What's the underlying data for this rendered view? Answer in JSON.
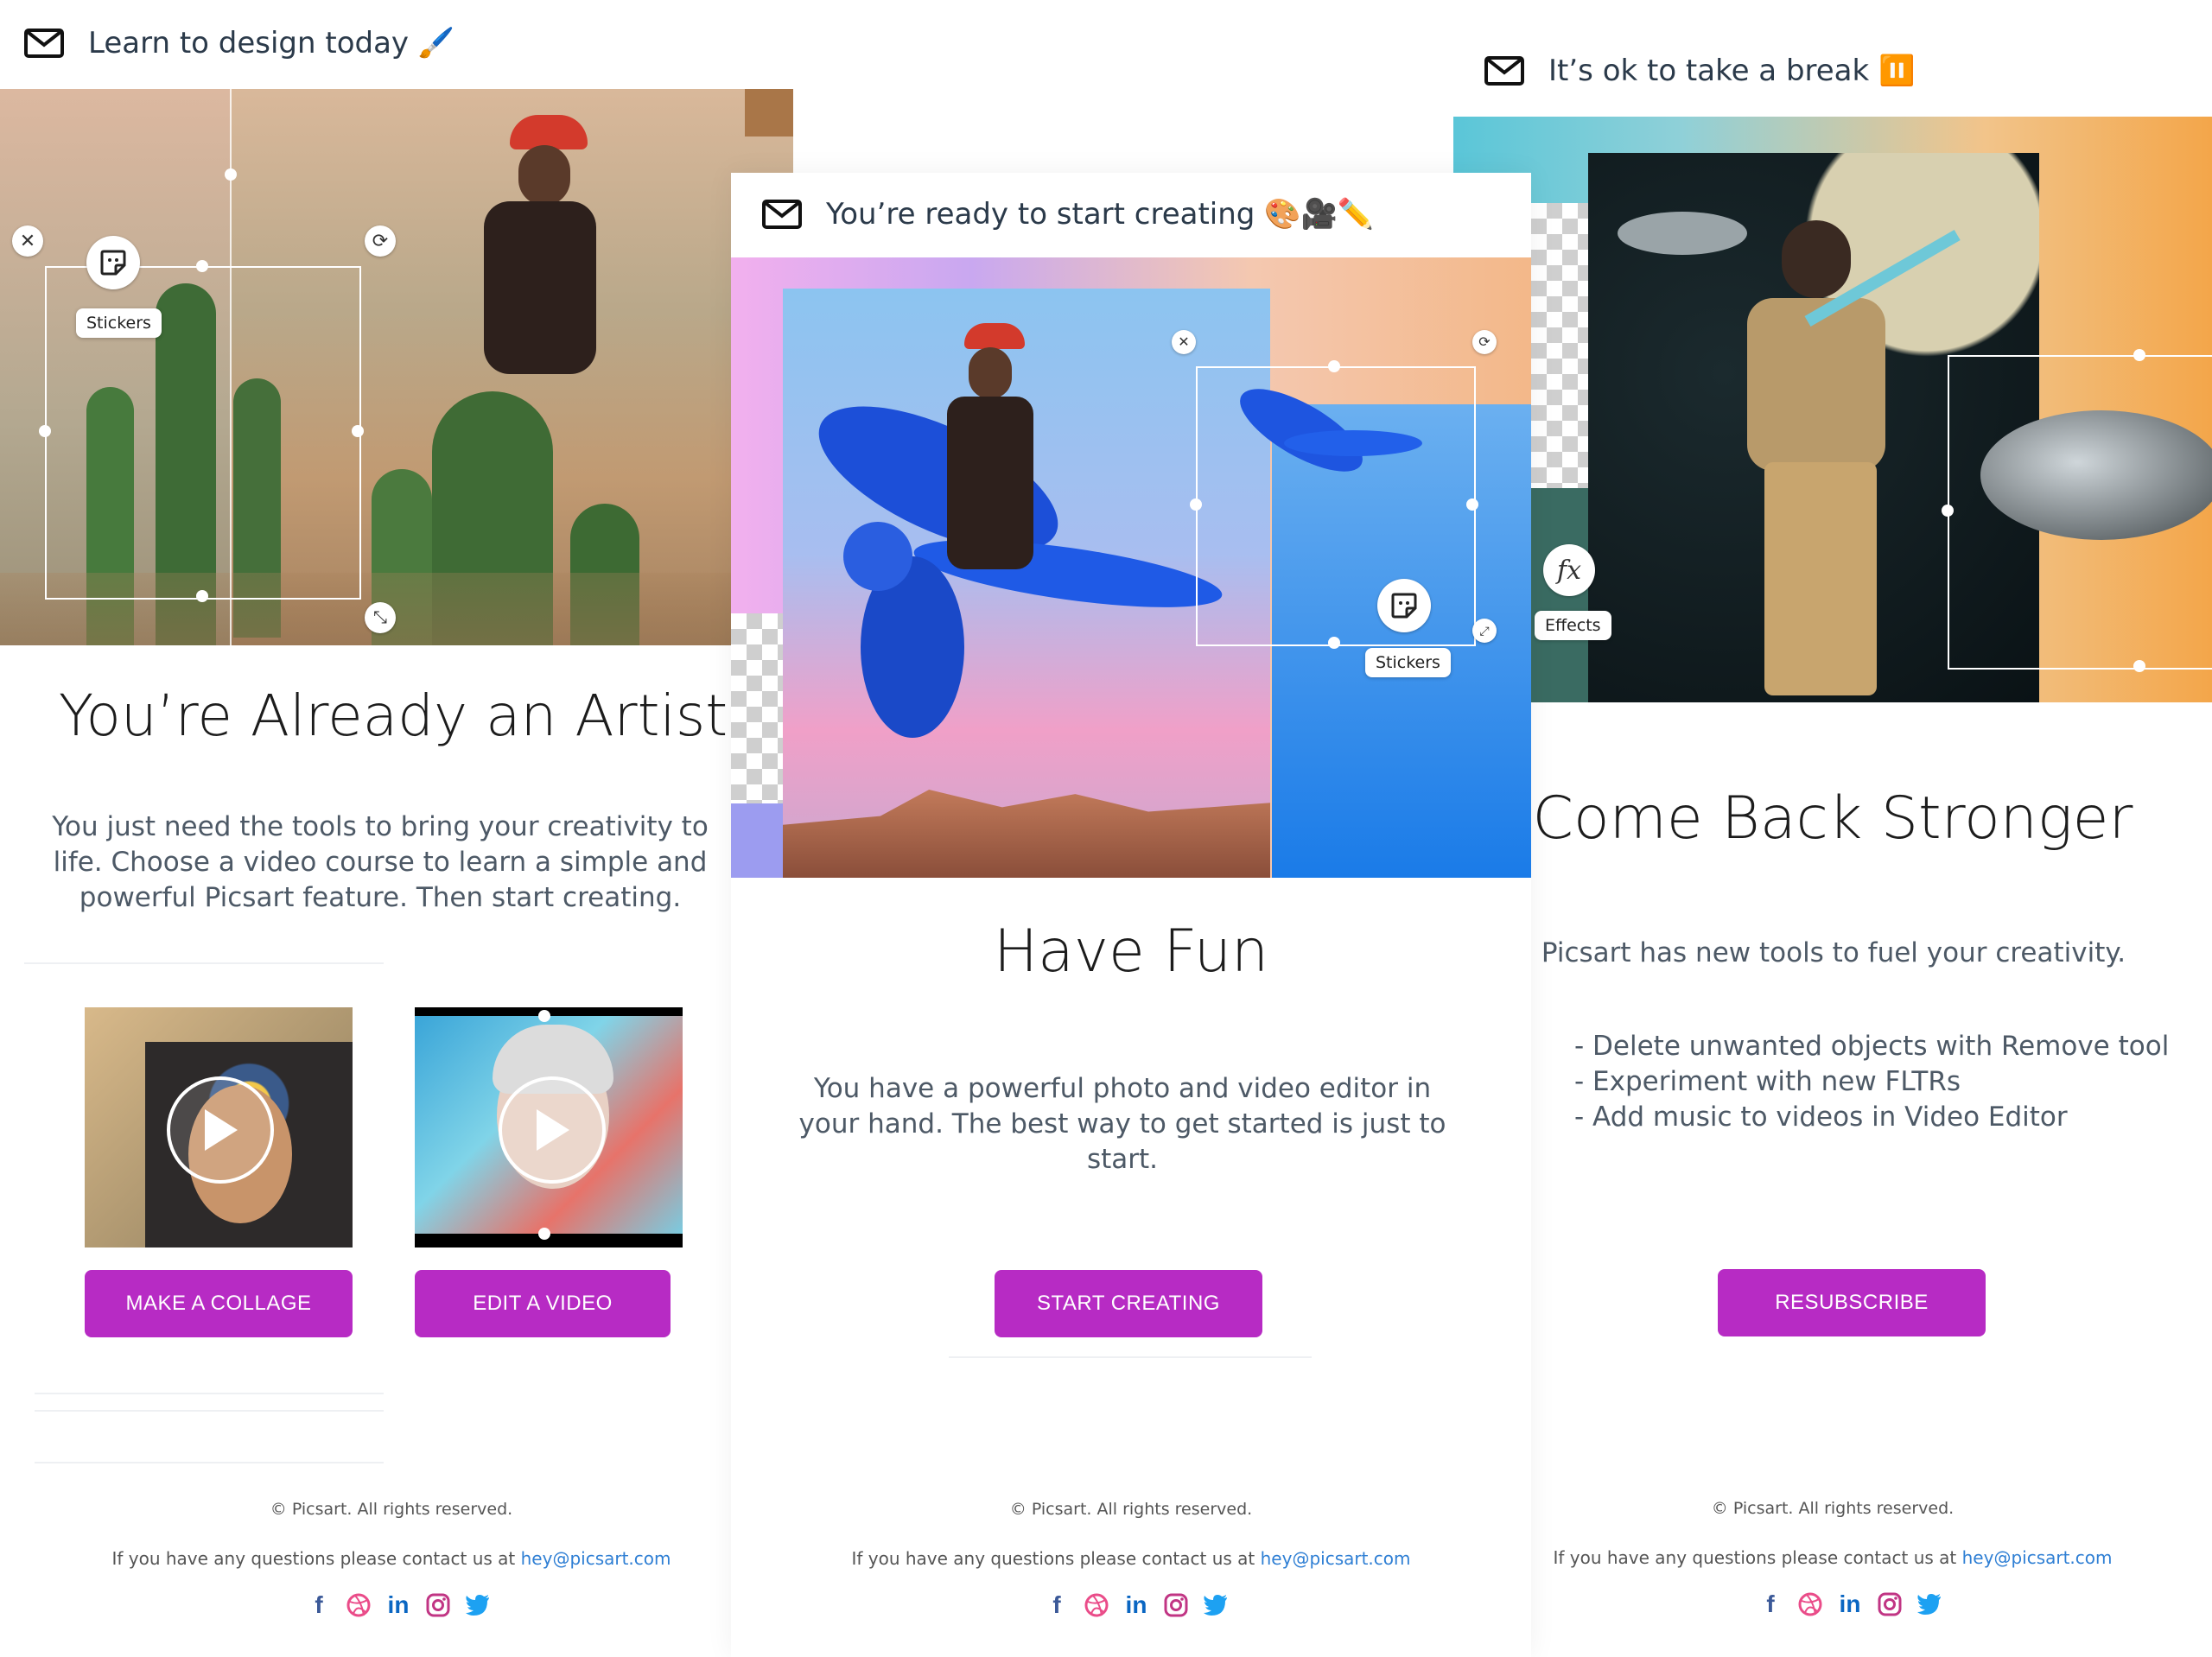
{
  "panel1": {
    "subject": "Learn to design today 🖌️",
    "title": "You’re Already an Artist",
    "body": "You just need the tools to bring your creativity to life. Choose a video course to learn a simple and powerful Picsart feature. Then start creating.",
    "sticker_tip": "Stickers",
    "btn_collage": "MAKE A COLLAGE",
    "btn_video": "EDIT A VIDEO"
  },
  "panel2": {
    "subject": "You’re ready to start creating 🎨🎥✏️",
    "title": "Have Fun",
    "body": "You have a powerful photo and video editor in your hand. The best way to get started is just to start.",
    "sticker_tip": "Stickers",
    "btn": "START CREATING"
  },
  "panel3": {
    "subject": "It’s ok to take a break ⏸️",
    "title": "Come Back Stronger",
    "body": "Picsart has new tools to fuel your creativity.",
    "bullets": [
      "- Delete unwanted objects with Remove tool",
      "- Experiment with new FLTRs",
      "- Add music to videos in Video Editor"
    ],
    "effects_tip": "Effects",
    "btn": "RESUBSCRIBE"
  },
  "footer": {
    "copyright": "© Picsart. All rights reserved.",
    "contact_prefix": "If you have any questions please contact us at ",
    "email": "hey@picsart.com"
  },
  "colors": {
    "accent": "#b72bc4",
    "link": "#2f7fd4"
  },
  "icons": [
    "envelope-icon",
    "facebook-icon",
    "dribbble-icon",
    "linkedin-icon",
    "instagram-icon",
    "twitter-icon",
    "play-icon",
    "sticker-icon",
    "fx-icon",
    "close-icon",
    "rotate-icon",
    "resize-icon"
  ]
}
